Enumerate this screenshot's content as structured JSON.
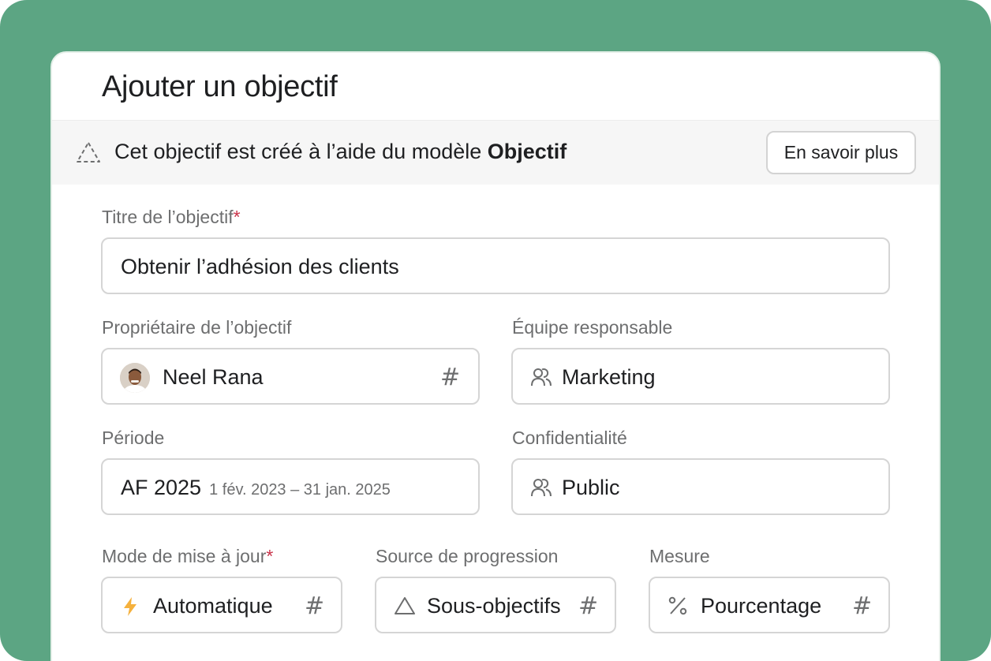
{
  "dialog": {
    "title": "Ajouter un objectif"
  },
  "banner": {
    "text_prefix": "Cet objectif est créé à l’aide du modèle ",
    "template_name": "Objectif",
    "learn_more_label": "En savoir plus"
  },
  "fields": {
    "title": {
      "label": "Titre de l’objectif",
      "required_mark": "*",
      "value": "Obtenir l’adhésion des clients"
    },
    "owner": {
      "label": "Propriétaire de l’objectif",
      "value": "Neel Rana",
      "trailing_icon": "hash-icon"
    },
    "team": {
      "label": "Équipe responsable",
      "value": "Marketing",
      "icon": "team-icon"
    },
    "period": {
      "label": "Période",
      "value": "AF 2025",
      "range": "1 fév. 2023 – 31 jan. 2025"
    },
    "privacy": {
      "label": "Confidentialité",
      "value": "Public",
      "icon": "team-icon"
    },
    "update_mode": {
      "label": "Mode de mise à jour",
      "required_mark": "*",
      "value": "Automatique",
      "icon": "lightning-icon"
    },
    "progress_source": {
      "label": "Source de progression",
      "value": "Sous-objectifs",
      "icon": "triangle-icon"
    },
    "measure": {
      "label": "Mesure",
      "value": "Pourcentage",
      "icon": "percent-icon"
    }
  },
  "theme": {
    "background": "#5ca583",
    "required": "#c9334a",
    "lightning": "#f5b13d"
  },
  "icons": {
    "hash": "#"
  }
}
